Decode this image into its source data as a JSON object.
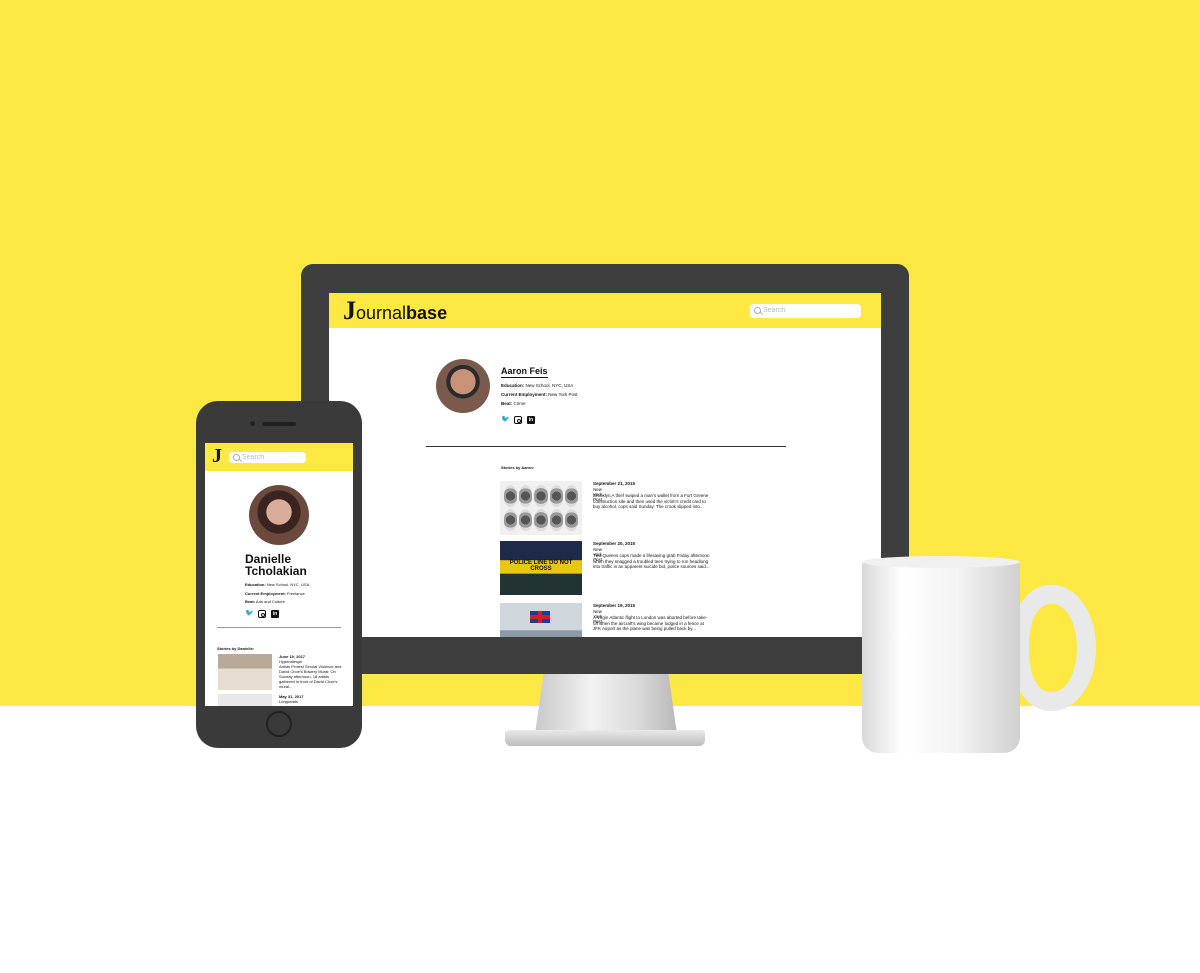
{
  "colors": {
    "brand_yellow": "#fee844",
    "device_frame": "#3e3e3e"
  },
  "desktop": {
    "logo_j": "J",
    "logo_thin": "ournal",
    "logo_bold": "base",
    "search_placeholder": "Search",
    "profile": {
      "name": "Aaron Feis",
      "education_label": "Education:",
      "education_value": "New School, NYC, USA",
      "employment_label": "Current Employment:",
      "employment_value": "New York Post",
      "beat_label": "Beat:",
      "beat_value": "Crime",
      "social_icons": [
        "twitter-icon",
        "instagram-icon",
        "linkedin-icon"
      ]
    },
    "stories_label": "Stories by Aaron:",
    "stories": [
      {
        "date": "September 21, 2015",
        "publication": "New York Post",
        "excerpt": "Brooklyn A thief swiped a man's wallet from a Fort Greene construction site and then used the victim's credit card to buy alcohol, cops said Sunday. The crook slipped into..."
      },
      {
        "date": "September 20, 2015",
        "publication": "New York Post",
        "excerpt": "Two Queens cops made a lifesaving grab Friday afternoon when they snagged a troubled teen trying to run headlong into traffic in an apparent suicide bid, police sources said...",
        "thumb_text": "POLICE LINE DO NOT CROSS"
      },
      {
        "date": "September 19, 2015",
        "publication": "New York Post",
        "excerpt": "A Virgin Atlantic flight to London was aborted before take-off when the aircraft's wing became lodged in a fence at JFK Airport as the plane was being pulled back by..."
      }
    ]
  },
  "mobile": {
    "logo_j": "J",
    "search_placeholder": "Search",
    "profile": {
      "name": "Danielle Tcholakian",
      "education_label": "Education:",
      "education_value": "New School, NYC, USA",
      "employment_label": "Current Employment:",
      "employment_value": "Freelance",
      "beat_label": "Beat:",
      "beat_value": "Arts and Culture"
    },
    "stories_label": "Stories by Danielle:",
    "stories": [
      {
        "date": "June 19, 2017",
        "publication": "Hyperallergic",
        "excerpt": "Artists Protest Sexual Violence and David Choe's Bowery Mural: On Sunday afternoon, 18 artists gathered in front of David Choe's mural..."
      },
      {
        "date": "May 31, 2017",
        "publication": "Longreads",
        "excerpt": ""
      }
    ]
  }
}
